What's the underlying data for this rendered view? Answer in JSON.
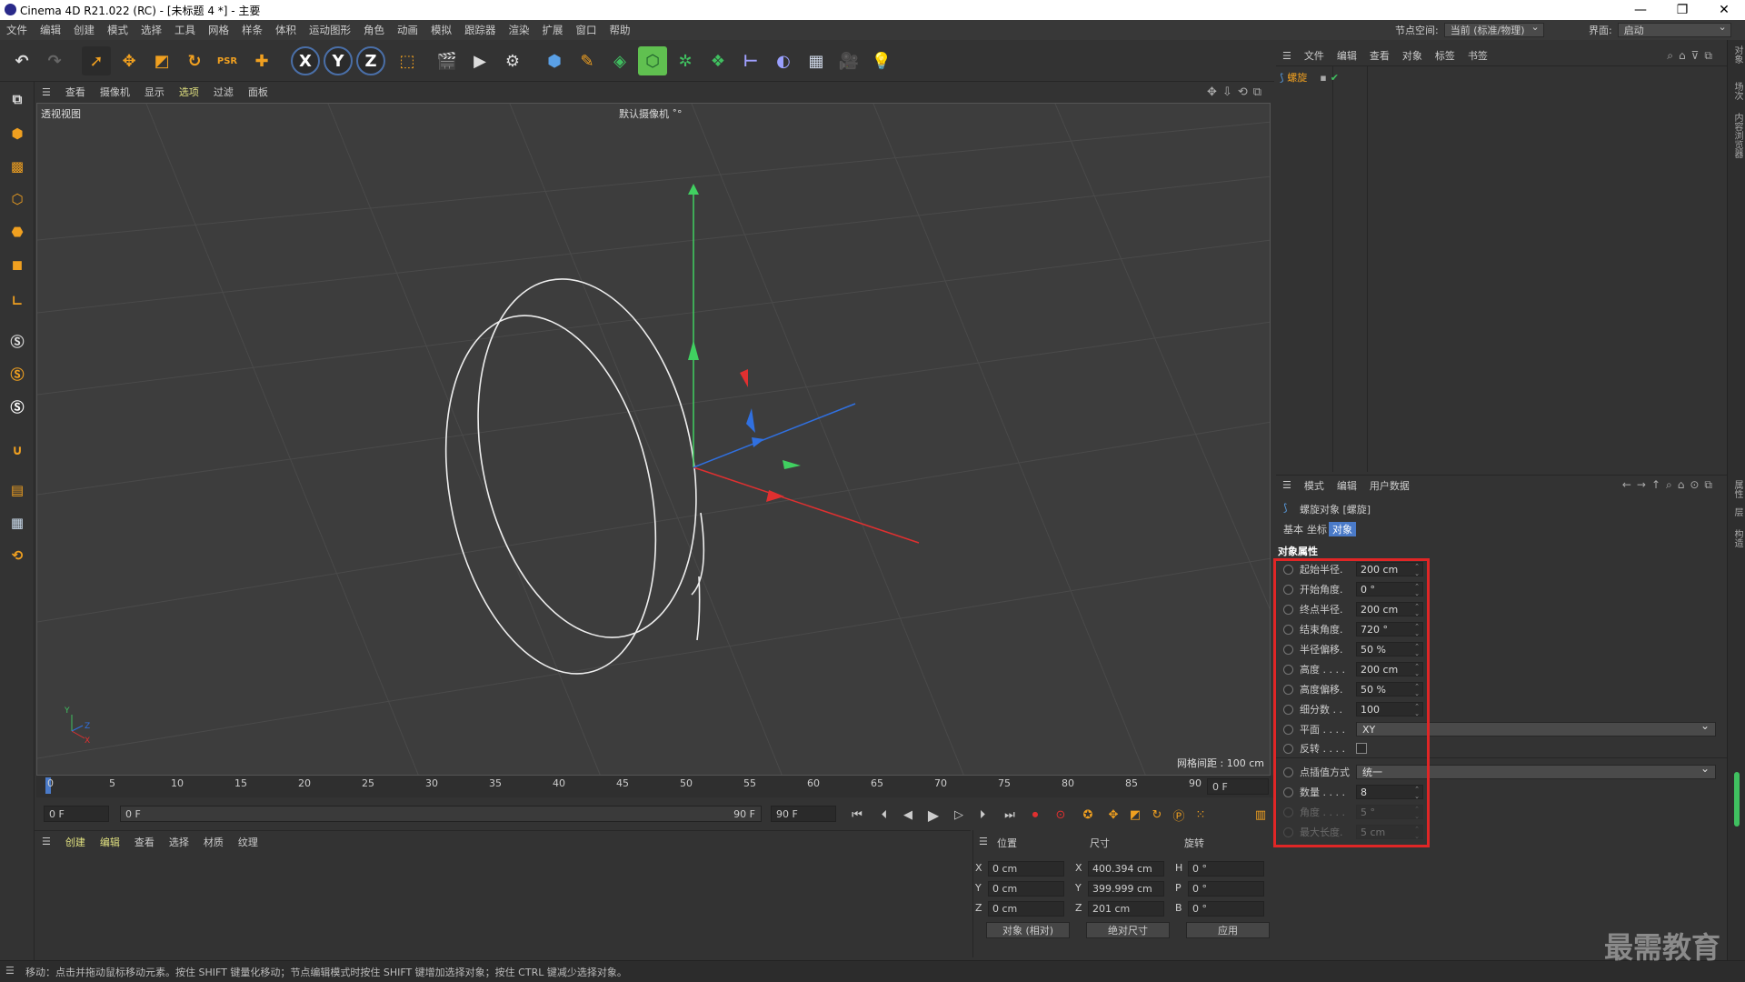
{
  "window": {
    "title": "Cinema 4D R21.022 (RC) - [未标题 4 *] - 主要",
    "minimize": "—",
    "restore": "❐",
    "close": "✕"
  },
  "menubar": {
    "items": [
      "文件",
      "编辑",
      "创建",
      "模式",
      "选择",
      "工具",
      "网格",
      "样条",
      "体积",
      "运动图形",
      "角色",
      "动画",
      "模拟",
      "跟踪器",
      "渲染",
      "扩展",
      "窗口",
      "帮助"
    ],
    "node_space_label": "节点空间:",
    "node_space_value": "当前 (标准/物理)",
    "layout_label": "界面:",
    "layout_value": "启动"
  },
  "viewport": {
    "menu": [
      "查看",
      "摄像机",
      "显示",
      "选项",
      "过滤",
      "面板"
    ],
    "view_name": "透视视图",
    "camera_name": "默认摄像机 ˚°",
    "grid_info": "网格间距 : 100 cm",
    "axis_labels": {
      "y": "Y",
      "z": "Z",
      "x": "X"
    }
  },
  "timeline": {
    "ticks": [
      "0",
      "5",
      "10",
      "15",
      "20",
      "25",
      "30",
      "35",
      "40",
      "45",
      "50",
      "55",
      "60",
      "65",
      "70",
      "75",
      "80",
      "85",
      "90"
    ],
    "current_frame_field": "0 F",
    "start_field": "0 F",
    "range_start": "0 F",
    "range_end": "90 F",
    "end_field": "90 F"
  },
  "material": {
    "menu": [
      "创建",
      "编辑",
      "查看",
      "选择",
      "材质",
      "纹理"
    ]
  },
  "coords": {
    "headers": {
      "position": "位置",
      "size": "尺寸",
      "rotation": "旋转"
    },
    "pos": [
      {
        "axis": "X",
        "value": "0 cm"
      },
      {
        "axis": "Y",
        "value": "0 cm"
      },
      {
        "axis": "Z",
        "value": "0 cm"
      }
    ],
    "size": [
      {
        "axis": "X",
        "value": "400.394 cm"
      },
      {
        "axis": "Y",
        "value": "399.999 cm"
      },
      {
        "axis": "Z",
        "value": "201 cm"
      }
    ],
    "rot": [
      {
        "axis": "H",
        "value": "0 °"
      },
      {
        "axis": "P",
        "value": "0 °"
      },
      {
        "axis": "B",
        "value": "0 °"
      }
    ],
    "mode_dd": "对象 (相对)",
    "size_dd": "绝对尺寸",
    "apply": "应用"
  },
  "status": "移动：点击并拖动鼠标移动元素。按住 SHIFT 键量化移动；节点编辑模式时按住 SHIFT 键增加选择对象；按住 CTRL 键减少选择对象。",
  "object_manager": {
    "menu": [
      "文件",
      "编辑",
      "查看",
      "对象",
      "标签",
      "书签"
    ],
    "object_name": "螺旋"
  },
  "attribute_manager": {
    "menu": [
      "模式",
      "编辑",
      "用户数据"
    ],
    "object_title": "螺旋对象 [螺旋]",
    "tabs": [
      "基本",
      "坐标",
      "对象"
    ],
    "active_tab": "对象",
    "section": "对象属性",
    "params": [
      {
        "label": "起始半径.",
        "value": "200 cm"
      },
      {
        "label": "开始角度.",
        "value": "0 °"
      },
      {
        "label": "终点半径.",
        "value": "200 cm"
      },
      {
        "label": "结束角度.",
        "value": "720 °"
      },
      {
        "label": "半径偏移.",
        "value": "50 %"
      },
      {
        "label": "高度 . . . .",
        "value": "200 cm"
      },
      {
        "label": "高度偏移.",
        "value": "50 %"
      },
      {
        "label": "细分数 . .",
        "value": "100"
      }
    ],
    "plane_label": "平面 . . . .",
    "plane_value": "XY",
    "reverse_label": "反转 . . . .",
    "interp_label": "点插值方式",
    "interp_value": "统一",
    "count_label": "数量 . . . .",
    "count_value": "8",
    "angle_label": "角度 . . . .",
    "angle_value": "5 °",
    "maxlen_label": "最大长度.",
    "maxlen_value": "5 cm"
  },
  "right_strip": {
    "tab1": "对象",
    "tab2": "场次",
    "tab3": "内容浏览器",
    "tab4": "属性",
    "tab5": "层",
    "tab6": "构造"
  },
  "watermark": "最需教育"
}
